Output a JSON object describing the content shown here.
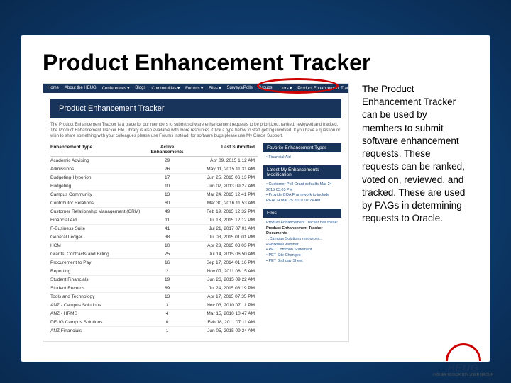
{
  "title": "Product Enhancement Tracker",
  "callout": "The Product Enhancement Tracker can be used by members to submit software enhancement requests. These requests can be ranked, voted on, reviewed, and tracked. These are used by PAGs in determining requests to Oracle.",
  "nav": {
    "items": [
      "Home",
      "About the HEUG",
      "Conferences ▾",
      "Blogs",
      "Communities ▾",
      "Forums ▾",
      "Files ▾",
      "Surveys/Polls",
      "Groups"
    ],
    "right_items": [
      "...tors ▾",
      "Product Enhancement Tracker ▾"
    ]
  },
  "banner": "Product Enhancement Tracker",
  "intro": "The Product Enhancement Tracker is a place for our members to submit software enhancement requests to be prioritized, ranked, reviewed and tracked. The Product Enhancement Tracker File Library is also available with more resources. Click a type below to start getting involved. If you have a question or wish to share something with your colleagues please use Forums instead; for software bugs please use My Oracle Support.",
  "table": {
    "headers": {
      "type": "Enhancement Type",
      "count": "Active Enhancements",
      "date": "Last Submitted"
    },
    "rows": [
      {
        "type": "Academic Advising",
        "count": "29",
        "date": "Apr 09, 2015 1:12 AM"
      },
      {
        "type": "Admissions",
        "count": "26",
        "date": "May 11, 2015 11:31 AM"
      },
      {
        "type": "Budgeting-Hyperion",
        "count": "17",
        "date": "Jun 25, 2015 06:13 PM"
      },
      {
        "type": "Budgeting",
        "count": "10",
        "date": "Jun 02, 2013 09:27 AM"
      },
      {
        "type": "Campus Community",
        "count": "13",
        "date": "Mar 24, 2015 12:41 PM"
      },
      {
        "type": "Contributor Relations",
        "count": "60",
        "date": "Mar 30, 2016 11:53 AM"
      },
      {
        "type": "Customer Relationship Management (CRM)",
        "count": "49",
        "date": "Feb 19, 2015 12:32 PM"
      },
      {
        "type": "Financial Aid",
        "count": "11",
        "date": "Jul 13, 2015 12:12 PM"
      },
      {
        "type": "F-Business Suite",
        "count": "41",
        "date": "Jul 21, 2017 07:01 AM"
      },
      {
        "type": "General Ledger",
        "count": "38",
        "date": "Jul 08, 2015 01:01 PM"
      },
      {
        "type": "HCM",
        "count": "10",
        "date": "Apr 23, 2015 03:03 PM"
      },
      {
        "type": "Grants, Contracts and Billing",
        "count": "75",
        "date": "Jul 14, 2015 06:50 AM"
      },
      {
        "type": "Procurement to Pay",
        "count": "16",
        "date": "Sep 17, 2014 01:16 PM"
      },
      {
        "type": "Reporting",
        "count": "2",
        "date": "Nov 07, 2011 08:15 AM"
      },
      {
        "type": "Student Financials",
        "count": "19",
        "date": "Jun 26, 2015 09:22 AM"
      },
      {
        "type": "Student Records",
        "count": "89",
        "date": "Jul 24, 2015 08:19 PM"
      },
      {
        "type": "Tools and Technology",
        "count": "13",
        "date": "Apr 17, 2015 07:35 PM"
      },
      {
        "type": "ANZ - Campus Solutions",
        "count": "3",
        "date": "Nov 03, 2010 07:11 PM"
      },
      {
        "type": "ANZ - HRMS",
        "count": "4",
        "date": "Mar 15, 2010 10:47 AM"
      },
      {
        "type": "DEUG Campus Solutions",
        "count": "0",
        "date": "Feb 18, 2011 07:11 AM"
      },
      {
        "type": "ANZ Financials",
        "count": "1",
        "date": "Jun 05, 2015 09:24 AM"
      }
    ]
  },
  "sidebar": {
    "favorite_title": "Favorite Enhancement Types",
    "favorite_item": "• Financial Aid",
    "latest_title": "Latest My Enhancements Modification",
    "latest_items": [
      "• Customer Pell Grant defaults\n  Mar 24 2015 03:03 PM",
      "• Provide COA Framework to include REACH\n  Mar 25 2010 10:24 AM"
    ],
    "files_title": "Files",
    "files_intro": "Product Enhancement Tracker has these:",
    "files_heading": "Product Enhancement Tracker Documents",
    "files_sub": "...Campus Solutions resources...",
    "files_items": [
      "• workflow webinar",
      "• PET Common Statement",
      "• PET Site Changes",
      "• PET Birthday Sheet"
    ]
  },
  "logo": {
    "text": "HEUG",
    "sub": "HIGHER EDUCATION USER GROUP"
  }
}
